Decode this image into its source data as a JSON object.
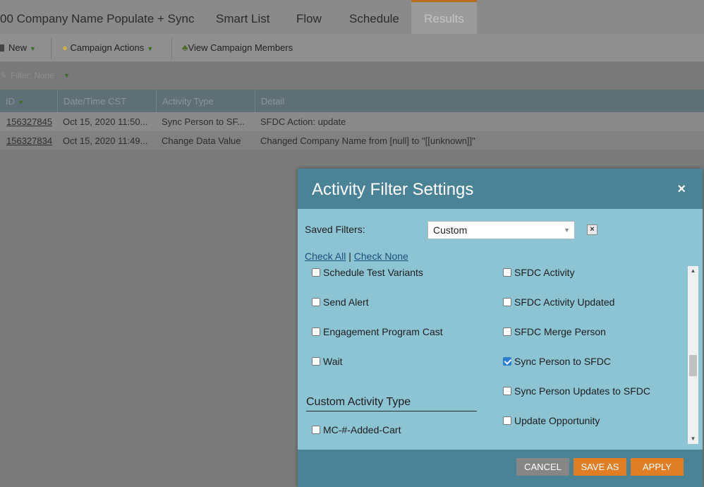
{
  "tabs": [
    {
      "label": "00 Company Name Populate + Sync"
    },
    {
      "label": "Smart List"
    },
    {
      "label": "Flow"
    },
    {
      "label": "Schedule"
    },
    {
      "label": "Results"
    }
  ],
  "toolbar": {
    "new_label": "New",
    "campaign_actions_label": "Campaign Actions",
    "view_members_label": "View Campaign Members"
  },
  "filter": {
    "label": "Filter: None"
  },
  "grid": {
    "columns": [
      "ID",
      "Date/Time CST",
      "Activity Type",
      "Detail"
    ],
    "rows": [
      {
        "id": "156327845",
        "datetime": "Oct 15, 2020 11:50...",
        "activity": "Sync Person to SF...",
        "detail": "SFDC Action: update"
      },
      {
        "id": "156327834",
        "datetime": "Oct 15, 2020 11:49...",
        "activity": "Change Data Value",
        "detail": "Changed Company Name from [null] to \"[[unknown]]\""
      }
    ]
  },
  "modal": {
    "title": "Activity Filter Settings",
    "close_icon": "×",
    "saved_filters_label": "Saved Filters:",
    "saved_filters_value": "Custom",
    "check_all": "Check All",
    "separator": "|",
    "check_none": "Check None",
    "left_options": [
      {
        "label": "Schedule Test Variants",
        "checked": false
      },
      {
        "label": "Send Alert",
        "checked": false
      },
      {
        "label": "Engagement Program Cast",
        "checked": false
      },
      {
        "label": "Wait",
        "checked": false
      }
    ],
    "right_options": [
      {
        "label": "SFDC Activity",
        "checked": false
      },
      {
        "label": "SFDC Activity Updated",
        "checked": false
      },
      {
        "label": "SFDC Merge Person",
        "checked": false
      },
      {
        "label": "Sync Person to SFDC",
        "checked": true
      },
      {
        "label": "Sync Person Updates to SFDC",
        "checked": false
      },
      {
        "label": "Update Opportunity",
        "checked": false
      }
    ],
    "custom_section_title": "Custom Activity Type",
    "custom_options": [
      {
        "label": "MC-#-Added-Cart",
        "checked": false
      }
    ],
    "buttons": {
      "cancel": "CANCEL",
      "save_as": "SAVE AS",
      "apply": "APPLY"
    }
  }
}
